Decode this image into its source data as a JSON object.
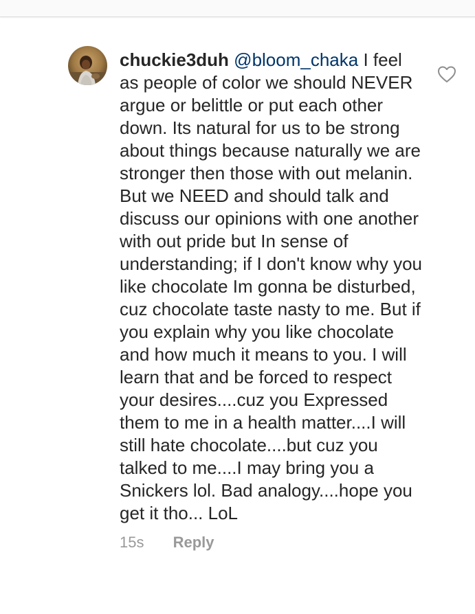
{
  "comment": {
    "username": "chuckie3duh",
    "mention": "@bloom_chaka",
    "text": "I feel as people of color we should NEVER argue or belittle or put each other down. Its natural for us to be strong about things because naturally we are stronger then those with out melanin. But we NEED and should talk and discuss our opinions with one another with out pride but In sense of understanding; if I don't know why you like chocolate Im gonna be disturbed, cuz chocolate taste nasty to me. But if you explain why you like chocolate and how much it means to you. I will learn that and be forced to respect your desires....cuz you Expressed them to me in a health matter....I will still hate chocolate....but cuz you talked to me....I may bring you a Snickers lol. Bad analogy....hope you get it tho... LoL",
    "timestamp": "15s",
    "reply_label": "Reply",
    "like_icon": "heart-outline-icon"
  },
  "colors": {
    "text": "#262626",
    "mention": "#003569",
    "meta": "#999999",
    "heart": "#8e8e8e"
  }
}
